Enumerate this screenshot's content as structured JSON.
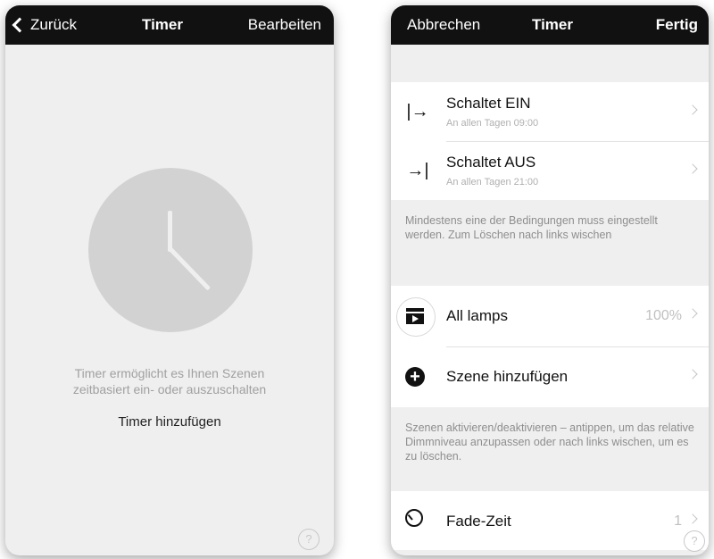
{
  "left_screen": {
    "nav": {
      "back_label": "Zurück",
      "title": "Timer",
      "edit_label": "Bearbeiten"
    },
    "empty_state": {
      "description_line1": "Timer ermöglicht es Ihnen Szenen",
      "description_line2": "zeitbasiert ein- oder auszuschalten",
      "add_label": "Timer hinzufügen"
    },
    "help_icon": "?"
  },
  "right_screen": {
    "nav": {
      "cancel_label": "Abbrechen",
      "title": "Timer",
      "done_label": "Fertig"
    },
    "timer_rows": [
      {
        "icon": "|→",
        "title": "Schaltet EIN",
        "subtitle": "An allen Tagen  09:00"
      },
      {
        "icon": "→|",
        "title": "Schaltet AUS",
        "subtitle": "An allen Tagen  21:00"
      }
    ],
    "conditions_note": "Mindestens eine der Bedingungen muss eingestellt werden. Zum Löschen nach links wischen",
    "scenes": [
      {
        "title": "All lamps",
        "value": "100%"
      }
    ],
    "add_scene_label": "Szene hinzufügen",
    "scenes_note": "Szenen aktivieren/deaktivieren – antippen, um das relative Dimmniveau anzupassen oder nach links wischen, um es zu löschen.",
    "fade": {
      "title": "Fade-Zeit",
      "value": "1"
    },
    "help_icon": "?"
  }
}
